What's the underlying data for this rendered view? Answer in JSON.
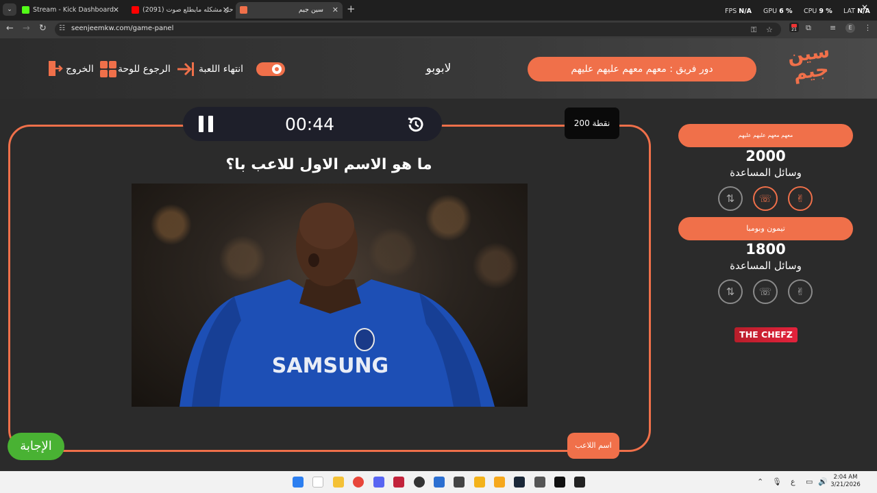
{
  "browser": {
    "tabs": [
      {
        "title": "Stream - Kick Dashboard",
        "favicon_color": "#53fc18"
      },
      {
        "title": "(2091) حل مشكله مايطلع صوت",
        "favicon_color": "#ff0000"
      },
      {
        "title": "سين جيم",
        "favicon_color": "#f0704a"
      }
    ],
    "new_tab": "+",
    "close_glyph": "✕",
    "perf": {
      "fps_label": "FPS",
      "fps_value": "N/A",
      "gpu_label": "GPU",
      "gpu_value": "6 %",
      "cpu_label": "CPU",
      "cpu_value": "9 %",
      "lat_label": "LAT",
      "lat_value": "N/A"
    },
    "url": "seenjeemkw.com/game-panel",
    "extension_badge": "21",
    "profile_initial": "E"
  },
  "header": {
    "exit_label": "الخروج",
    "back_label": "الرجوع للوحة",
    "end_label": "انتهاء اللعبة",
    "center_name": "لابوبو",
    "turn_text": "دور فريق : معهم معهم عليهم عليهم",
    "logo_text": "سين جيم",
    "accent_color": "#f0704a"
  },
  "question_panel": {
    "timer": "00:44",
    "points": "200 نقطة",
    "question": "ما هو الاسم الاول للاعب با؟",
    "answer_tag": "اسم اللاعب",
    "answer_button": "الإجابة"
  },
  "teams": [
    {
      "name": "معهم معهم عليهم عليهم",
      "score": "2000",
      "aids_label": "وسائل المساعدة",
      "aids": [
        {
          "icon": "swap-icon",
          "used": false
        },
        {
          "icon": "phone-icon",
          "used": true
        },
        {
          "icon": "peace-hand-icon",
          "used": true
        }
      ]
    },
    {
      "name": "تيمون وبومبا",
      "score": "1800",
      "aids_label": "وسائل المساعدة",
      "aids": [
        {
          "icon": "swap-icon",
          "used": false
        },
        {
          "icon": "phone-icon",
          "used": false
        },
        {
          "icon": "peace-hand-icon",
          "used": false
        }
      ]
    }
  ],
  "sponsor": "THE CHEFZ",
  "taskbar": {
    "time": "2:04 AM",
    "date": "3/21/2026",
    "lang": "ع"
  }
}
